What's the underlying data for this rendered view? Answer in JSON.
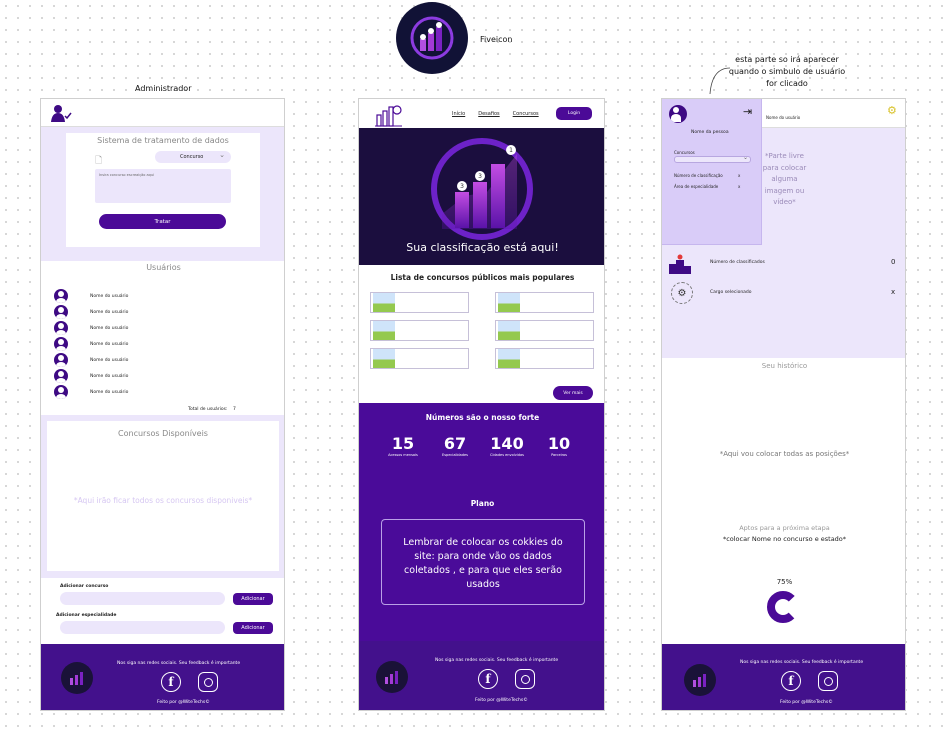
{
  "favicon": {
    "label": "Fiveicon"
  },
  "annotation": {
    "dropdown_note": "esta parte so irá aparecer quando o simbulo de usuário for clicado"
  },
  "admin": {
    "frame_title": "Administrador",
    "system_title": "Sistema de tratamento de dados",
    "select_value": "Concurso",
    "textarea_placeholder": "Insira concurso escreaição aqui",
    "process_button": "Tratar",
    "users_title": "Usuários",
    "users": [
      "Nome do usuário",
      "Nome do usuário",
      "Nome do usuário",
      "Nome do usuário",
      "Nome do usuário",
      "Nome do usuário",
      "Nome do usuário"
    ],
    "total_label": "Total de usuários:",
    "total_value": "7",
    "contests_title": "Concursos Disponíveis",
    "contests_placeholder": "*Aqui irão ficar todos os concursos disponiveis*",
    "add_contest_label": "Adicionar concurso",
    "add_specialty_label": "Adicionar especialidade",
    "add_button": "Adicionar"
  },
  "home": {
    "nav": [
      "Início",
      "Desafios",
      "Concursos"
    ],
    "login_button": "Login",
    "hero_text": "Sua classificação está aqui!",
    "popular_title": "Lista de concursos públicos mais populares",
    "see_more": "Ver mais",
    "stats_title": "Números são o nosso forte",
    "stats": [
      {
        "value": "15",
        "label": "Acessos mensais"
      },
      {
        "value": "67",
        "label": "Especialidades"
      },
      {
        "value": "140",
        "label": "Cidades envolvidas"
      },
      {
        "value": "10",
        "label": "Parceiros"
      }
    ],
    "plan_title": "Plano",
    "cookies_note": "Lembrar de colocar os cokkies do site: para onde vão os dados coletados , e para que eles serão usados"
  },
  "profile": {
    "user_name": "Nome da pessoa",
    "contest_label": "Concursos",
    "classification_label": "Número de classificação",
    "specialty_label": "Área de especialidade",
    "close_mark": "x",
    "header_user": "Nome do usuário",
    "free_area": "*Parte livre para colocar alguma imagem ou vídeo*",
    "classification_count_label": "Número de classificados",
    "classification_count": "0",
    "selected_role_label": "Cargo selecionado",
    "selected_role_value": "x",
    "history_title": "Seu histórico",
    "history_placeholder": "*Aqui vou colocar todas as posições*",
    "next_step": "Aptos para a próxima etapa",
    "next_step_note": "*colocar Nome no concurso e estado*",
    "progress_text": "75%",
    "progress": 0.75
  },
  "footer": {
    "social_text": "Nos siga nas redes sociais. Seu feedback é importante",
    "credit": "Feito por @WiteTechs©"
  },
  "colors": {
    "primary": "#4b0a97",
    "light": "#ece6fb",
    "footer": "#43118c"
  }
}
